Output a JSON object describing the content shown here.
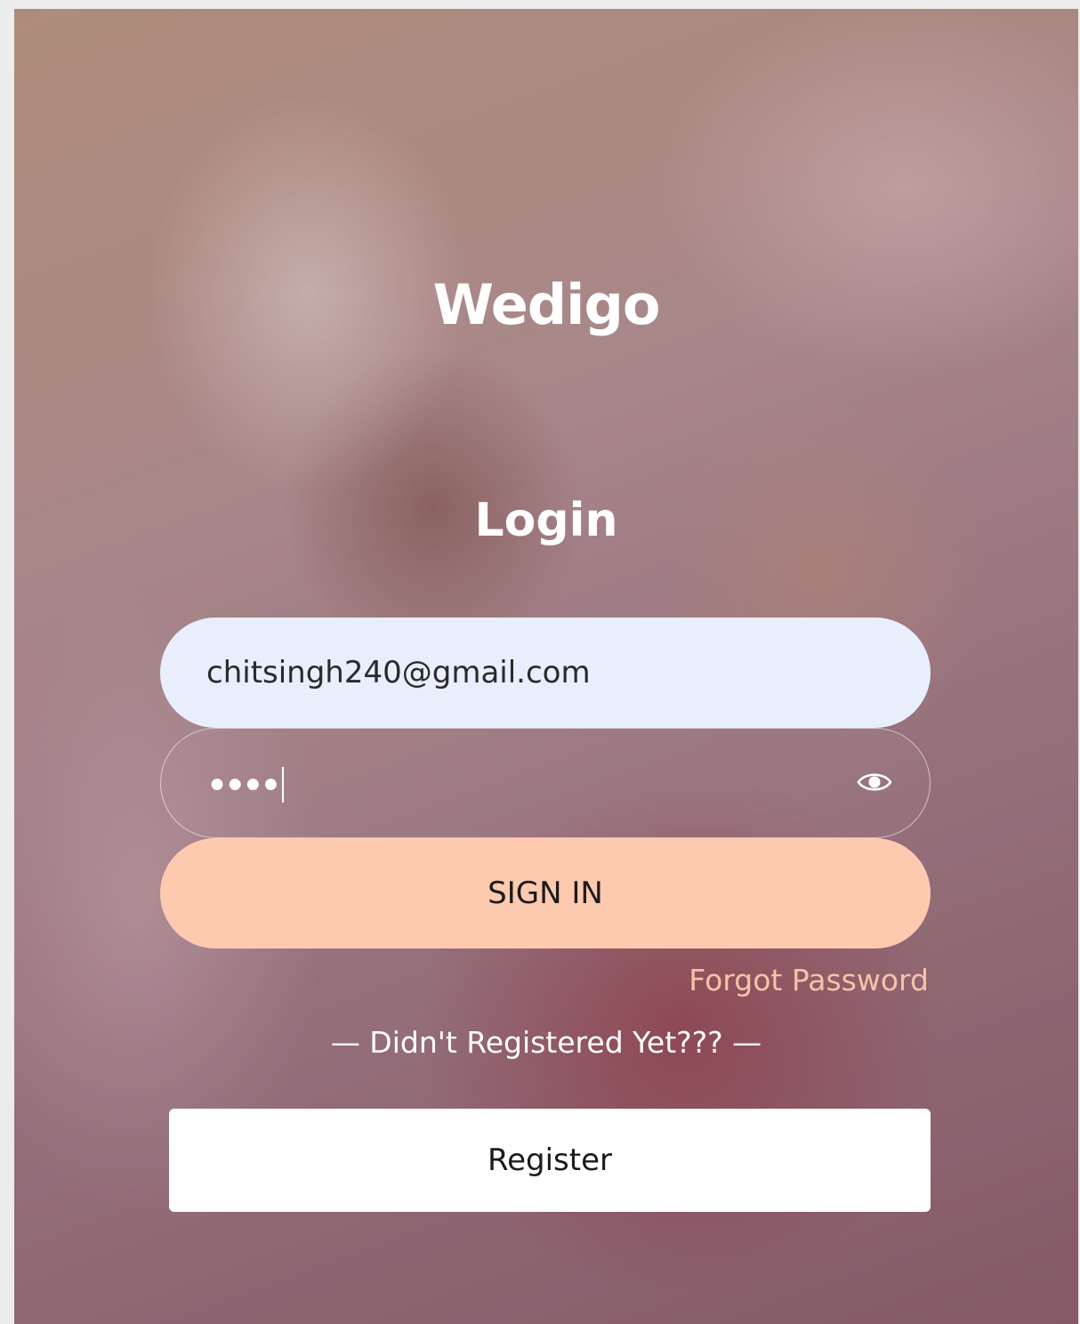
{
  "brand": {
    "name": "Wedigo"
  },
  "login": {
    "heading": "Login",
    "email_value": "chitsingh240@gmail.com",
    "password_mask": "●●●●",
    "show_password_icon": "eye-icon",
    "signin_label": "SIGN IN",
    "forgot_label": "Forgot Password",
    "divider_text": "— Didn't Registered Yet??? —",
    "register_label": "Register"
  },
  "colors": {
    "email_field_bg": "#e8eefc",
    "signin_bg": "#fdcab0",
    "forgot_link": "#f6c3a8",
    "register_bg": "#ffffff"
  },
  "background": {
    "type": "photo"
  }
}
